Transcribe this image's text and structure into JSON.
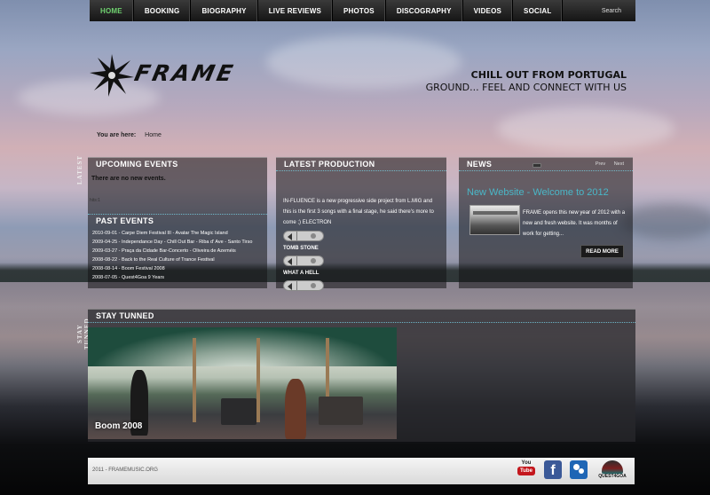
{
  "nav": {
    "items": [
      "HOME",
      "BOOKING",
      "BIOGRAPHY",
      "LIVE REVIEWS",
      "PHOTOS",
      "DISCOGRAPHY",
      "VIDEOS",
      "SOCIAL"
    ],
    "active": "HOME",
    "search_label": "Search"
  },
  "header": {
    "logo_text": "FRAME",
    "tagline_line1": "CHILL OUT FROM PORTUGAL",
    "tagline_line2": "GROUND... FEEL AND CONNECT WITH US"
  },
  "breadcrumb": {
    "prefix": "You are here:",
    "current": "Home"
  },
  "side_tabs": {
    "latest": "LATEST",
    "stay": "STAY TUNNED"
  },
  "events": {
    "title": "UPCOMING EVENTS",
    "none_text": "There are no new events.",
    "hits_text": "hits:1",
    "past_title": "PAST EVENTS",
    "past": [
      "2010-09-01 - Carpe Diem Festival III - Avatar The Magic Island",
      "2009-04-25 - Independance Day - Chill Out Bar - Riba d' Ave - Santo Tirso",
      "2009-03-27 - Praça da Cidade Bar-Concerto - Oliveira de Azeméis",
      "2008-08-22 - Back to the Real Culture of Trance Festival",
      "2008-08-14 - Boom Festival 2008",
      "2008-07-05 - Quest4Goa 9 Years"
    ]
  },
  "latest": {
    "title": "LATEST PRODUCTION",
    "body": "IN-FLUENCE is a new progressive side project from L.MIG and this is the first 3 songs with a final stage, he said there's more to come ;) ELECTRON",
    "tracks": [
      "TOMB STONE",
      "WHAT A HELL"
    ]
  },
  "news": {
    "title": "NEWS",
    "prev": "Prev",
    "next": "Next",
    "headline": "New Website - Welcome to 2012",
    "text": "FRAME opens this new year of 2012 with a new and fresh website. It was months of work for getting...",
    "read_more": "READ MORE"
  },
  "stay": {
    "title": "STAY TUNNED",
    "caption": "Boom 2008"
  },
  "footer": {
    "copyright": "2011 - FRAMEMUSIC.ORG",
    "youtube_top": "You",
    "youtube_tube": "Tube",
    "facebook": "f",
    "quest_label": "QUEST4GOA"
  },
  "colors": {
    "nav_active": "#6fd16f",
    "news_headline": "#49b7c8",
    "youtube_red": "#c4171d",
    "facebook_blue": "#3b5998",
    "myspace_blue": "#1f66b5"
  }
}
